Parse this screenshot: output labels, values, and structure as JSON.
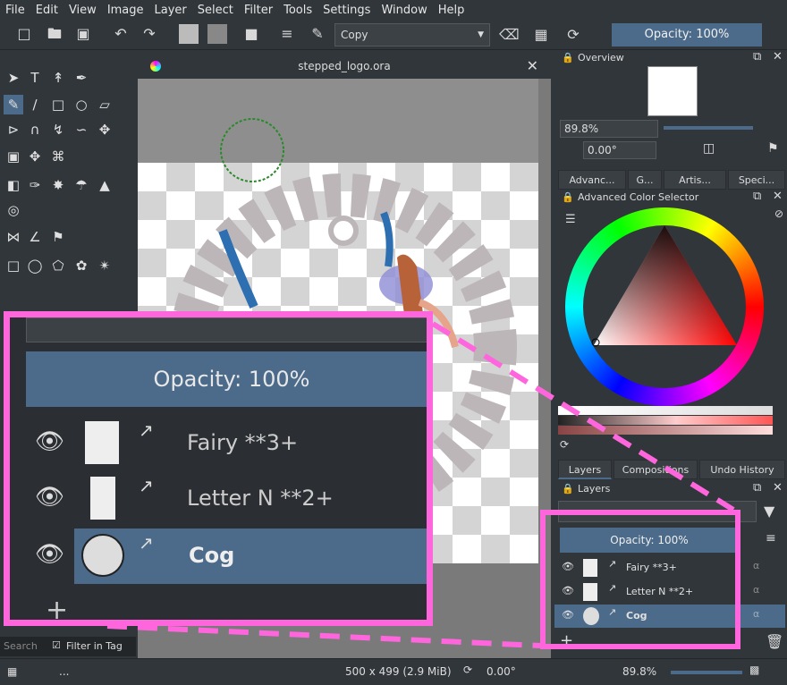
{
  "menu": [
    "File",
    "Edit",
    "View",
    "Image",
    "Layer",
    "Select",
    "Filter",
    "Tools",
    "Settings",
    "Window",
    "Help"
  ],
  "toolbar": {
    "blend_mode": "Copy",
    "opacity": "Opacity: 100%"
  },
  "document": {
    "title": "stepped_logo.ora"
  },
  "overview": {
    "title": "Overview",
    "zoom": "89.8%",
    "rotation": "0.00°"
  },
  "dock_tabs": [
    "Advanc...",
    "G...",
    "Artis...",
    "Speci..."
  ],
  "color_selector": {
    "title": "Advanced Color Selector"
  },
  "layer_tabs": [
    "Layers",
    "Compositions",
    "Undo History"
  ],
  "layers_panel": {
    "title": "Layers",
    "opacity": "Opacity:  100%",
    "layers": [
      {
        "name": "Fairy **3+",
        "selected": false
      },
      {
        "name": "Letter N **2+",
        "selected": false
      },
      {
        "name": "Cog",
        "selected": true
      }
    ]
  },
  "zoom_inset": {
    "opacity": "Opacity:  100%"
  },
  "brush_search": {
    "placeholder": "Search",
    "filter_label": "Filter in Tag"
  },
  "status": {
    "size": "500 x 499 (2.9 MiB)",
    "rotation": "0.00°",
    "zoom": "89.8%",
    "dots": "..."
  },
  "colors": {
    "accent": "#4c6b8a",
    "highlight": "#ff66dd",
    "bg": "#31363b"
  }
}
